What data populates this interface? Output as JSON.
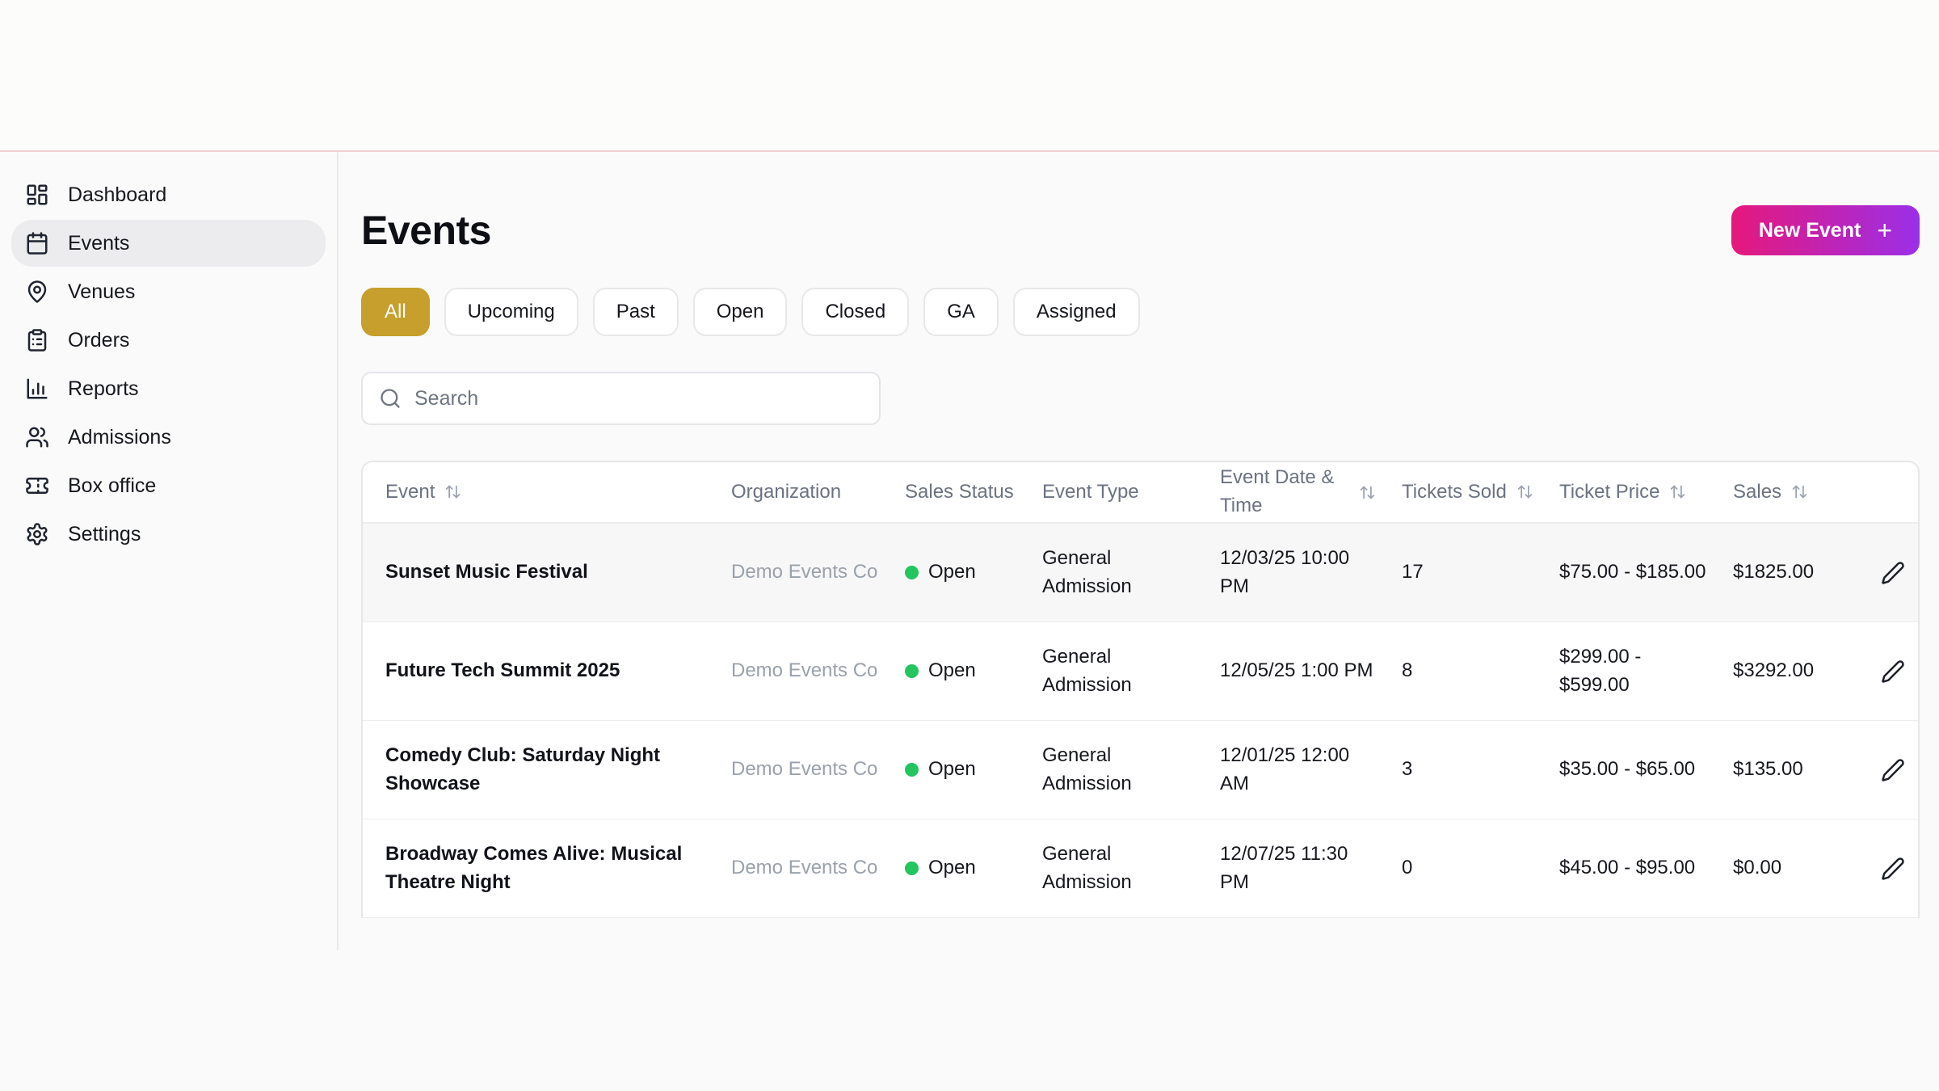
{
  "app": {
    "top_border_color": "#f2ced2"
  },
  "sidebar": {
    "items": [
      {
        "label": "Dashboard",
        "icon": "dashboard-icon"
      },
      {
        "label": "Events",
        "icon": "calendar-icon",
        "active": true
      },
      {
        "label": "Venues",
        "icon": "map-pin-icon"
      },
      {
        "label": "Orders",
        "icon": "clipboard-icon"
      },
      {
        "label": "Reports",
        "icon": "bar-chart-icon"
      },
      {
        "label": "Admissions",
        "icon": "users-icon"
      },
      {
        "label": "Box office",
        "icon": "ticket-icon"
      },
      {
        "label": "Settings",
        "icon": "gear-icon"
      }
    ]
  },
  "header": {
    "title": "Events",
    "new_event": {
      "label": "New Event",
      "plus": "+",
      "gradient_from": "#e6187c",
      "gradient_to": "#9b2fe8"
    }
  },
  "filters": {
    "active": "All",
    "active_bg": "#c79f2d",
    "pills": [
      {
        "label": "All"
      },
      {
        "label": "Upcoming"
      },
      {
        "label": "Past"
      },
      {
        "label": "Open"
      },
      {
        "label": "Closed"
      },
      {
        "label": "GA"
      },
      {
        "label": "Assigned"
      }
    ]
  },
  "search": {
    "placeholder": "Search"
  },
  "table": {
    "columns": [
      {
        "label": "Event",
        "sortable": true
      },
      {
        "label": "Organization",
        "sortable": false
      },
      {
        "label": "Sales Status",
        "sortable": false
      },
      {
        "label": "Event Type",
        "sortable": false
      },
      {
        "label": "Event Date & Time",
        "sortable": true
      },
      {
        "label": "Tickets Sold",
        "sortable": true
      },
      {
        "label": "Ticket Price",
        "sortable": true
      },
      {
        "label": "Sales",
        "sortable": true
      }
    ],
    "status_open_color": "#22c55e",
    "rows": [
      {
        "event": "Sunset Music Festival",
        "organization": "Demo Events Co",
        "sales_status": "Open",
        "event_type": "General Admission",
        "datetime": "12/03/25 10:00 PM",
        "tickets_sold": "17",
        "ticket_price": "$75.00 - $185.00",
        "sales": "$1825.00"
      },
      {
        "event": "Future Tech Summit 2025",
        "organization": "Demo Events Co",
        "sales_status": "Open",
        "event_type": "General Admission",
        "datetime": "12/05/25 1:00 PM",
        "tickets_sold": "8",
        "ticket_price": "$299.00 - $599.00",
        "sales": "$3292.00"
      },
      {
        "event": "Comedy Club: Saturday Night Showcase",
        "organization": "Demo Events Co",
        "sales_status": "Open",
        "event_type": "General Admission",
        "datetime": "12/01/25 12:00 AM",
        "tickets_sold": "3",
        "ticket_price": "$35.00 - $65.00",
        "sales": "$135.00"
      },
      {
        "event": "Broadway Comes Alive: Musical Theatre Night",
        "organization": "Demo Events Co",
        "sales_status": "Open",
        "event_type": "General Admission",
        "datetime": "12/07/25 11:30 PM",
        "tickets_sold": "0",
        "ticket_price": "$45.00 - $95.00",
        "sales": "$0.00"
      }
    ]
  }
}
